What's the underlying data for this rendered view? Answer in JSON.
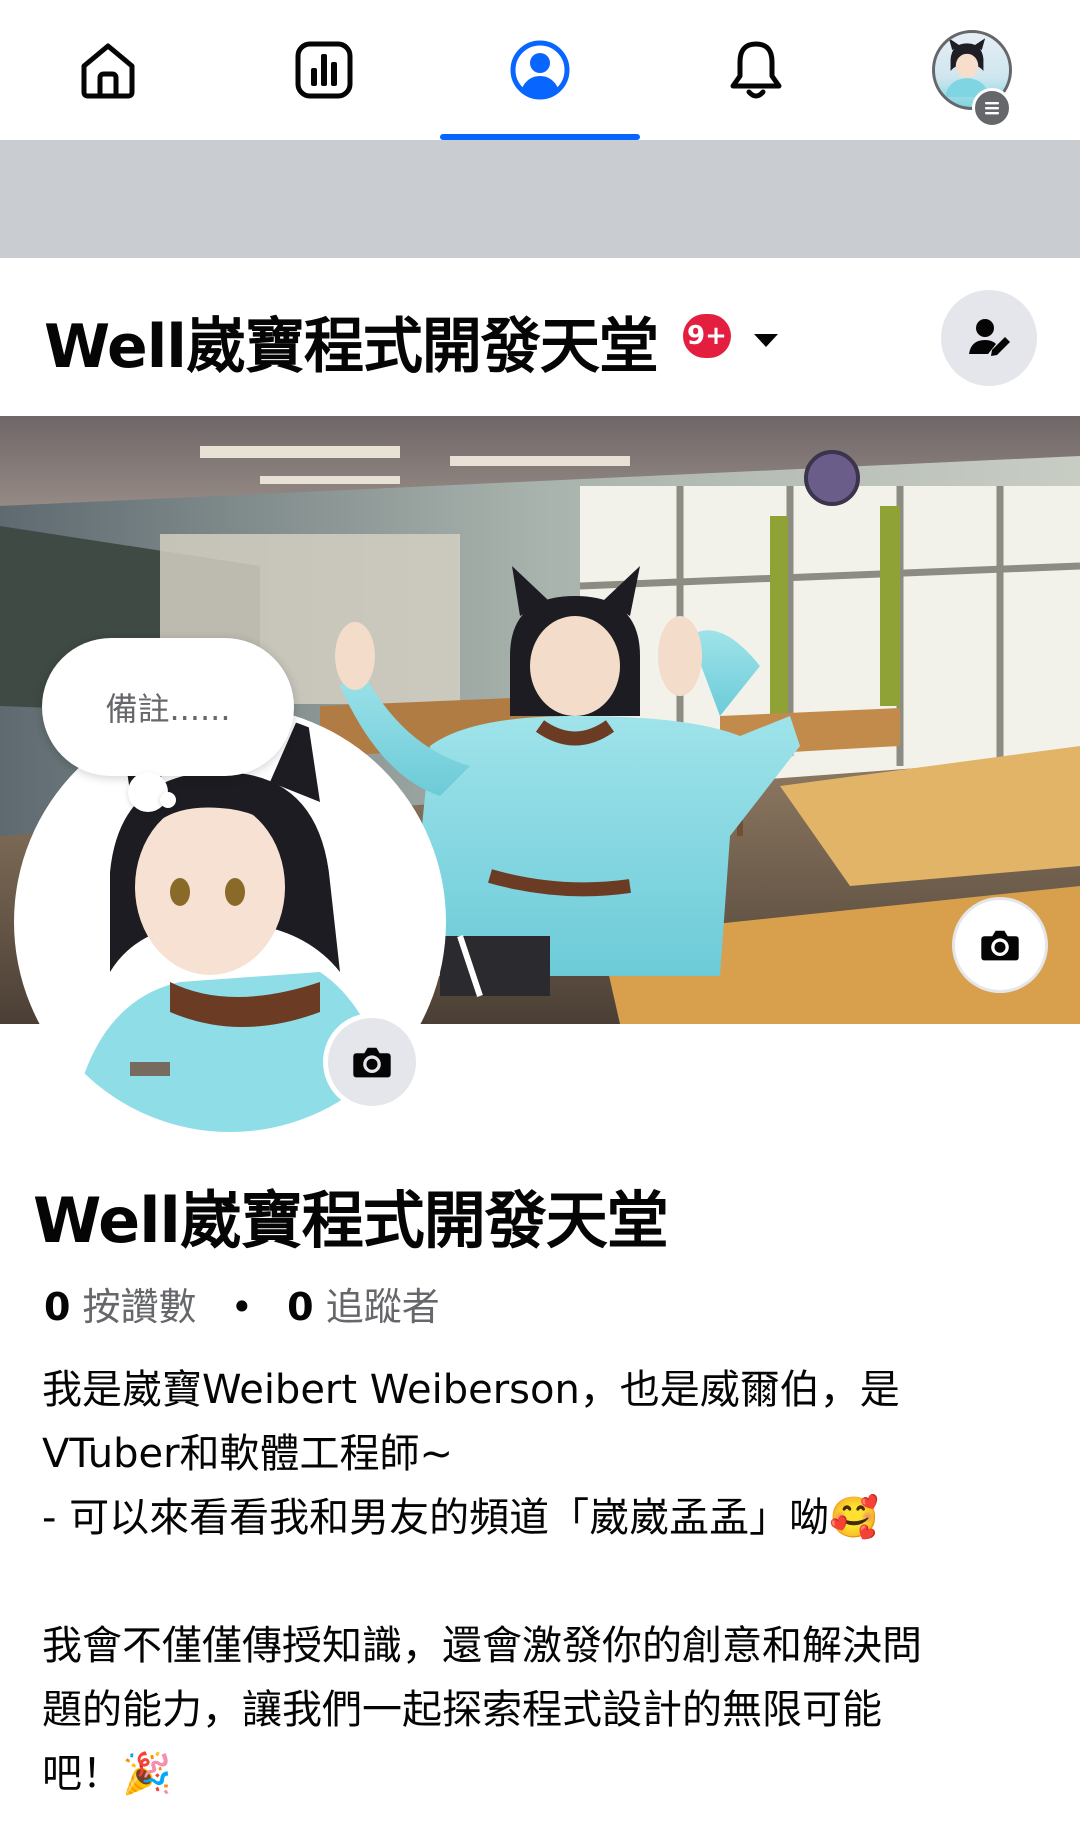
{
  "nav": {
    "tabs": [
      {
        "name": "home",
        "icon": "home-icon"
      },
      {
        "name": "dashboard",
        "icon": "bar-chart-icon"
      },
      {
        "name": "profile",
        "icon": "profile-icon",
        "active": true
      },
      {
        "name": "notifications",
        "icon": "bell-icon"
      },
      {
        "name": "menu",
        "icon": "avatar-menu-icon"
      }
    ],
    "accent_color": "#0866ff"
  },
  "header": {
    "title": "Well崴寶程式開發天堂",
    "notification_badge": "9+"
  },
  "profile": {
    "note_placeholder": "備註......",
    "name": "Well崴寶程式開發天堂",
    "likes_count": "0",
    "likes_label": "按讚數",
    "separator": "•",
    "followers_count": "0",
    "followers_label": "追蹤者",
    "bio": "我是崴寶Weibert Weiberson，也是威爾伯，是\nVTuber和軟體工程師~\n- 可以來看看我和男友的頻道「崴崴孟孟」呦🥰\n\n我會不僅僅傳授知識，還會激發你的創意和解決問\n題的能力，讓我們一起探索程式設計的無限可能\n吧！🎉"
  }
}
